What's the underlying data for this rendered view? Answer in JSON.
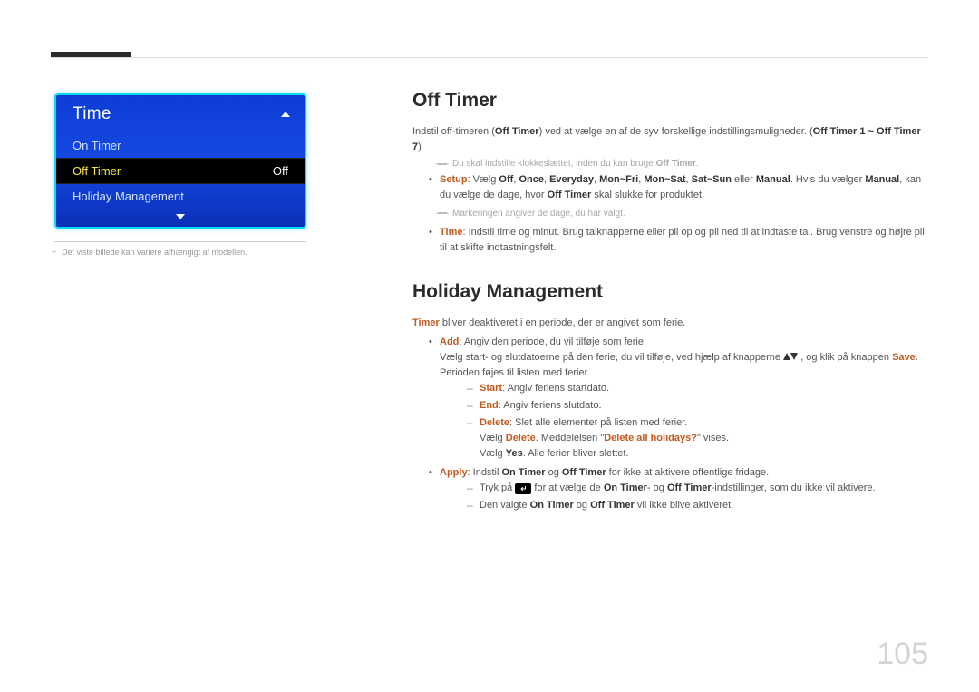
{
  "tv": {
    "title": "Time",
    "items": {
      "on_timer": "On Timer",
      "off_timer_label": "Off Timer",
      "off_timer_value": "Off",
      "holiday": "Holiday Management"
    }
  },
  "sidebar_caption": "Det viste billede kan variere afhængigt af modellen.",
  "section_off": {
    "heading": "Off Timer",
    "intro_a": "Indstil off-timeren (",
    "intro_bold": "Off Timer",
    "intro_b": ") ved at vælge en af de syv forskellige indstillingsmuligheder. (",
    "intro_range": "Off Timer 1 ~ Off Timer 7",
    "intro_c": ")",
    "note_prefix": "Du skal indstille klokkeslættet, inden du kan bruge ",
    "note_bold": "Off Timer",
    "setup_label": "Setup",
    "setup_text_a": ": Vælg ",
    "opt_off": "Off",
    "opt_once": "Once",
    "opt_everyday": "Everyday",
    "opt_monfri": "Mon~Fri",
    "opt_monsat": "Mon~Sat",
    "opt_satsun": "Sat~Sun",
    "opt_manual": "Manual",
    "setup_text_b": ". Hvis du vælger ",
    "setup_text_c": ", kan du vælge de dage, hvor ",
    "setup_text_d": " skal slukke for produktet.",
    "setup_note": "Markeringen angiver de dage, du har valgt.",
    "time_label": "Time",
    "time_text": ": Indstil time og minut. Brug talknapperne eller pil op og pil ned til at indtaste tal. Brug venstre og højre pil til at skifte indtastningsfelt."
  },
  "section_hol": {
    "heading": "Holiday Management",
    "intro_timer": "Timer",
    "intro_text": " bliver deaktiveret i en periode, der er angivet som ferie.",
    "add_label": "Add",
    "add_text": ": Angiv den periode, du vil tilføje som ferie.",
    "add_line2a": "Vælg start- og slutdatoerne på den ferie, du vil tilføje, ved hjælp af knapperne ",
    "add_line2b": ", og klik på knappen ",
    "save": "Save",
    "add_line3": "Perioden føjes til listen med ferier.",
    "start_label": "Start",
    "start_text": ": Angiv feriens startdato.",
    "end_label": "End",
    "end_text": ": Angiv feriens slutdato.",
    "delete_label": "Delete",
    "delete_text": ": Slet alle elementer på listen med ferier.",
    "delete_line2a": "Vælg ",
    "delete_bold": "Delete",
    "delete_line2b": ". Meddelelsen \"",
    "delete_q": "Delete all holidays?",
    "delete_line2c": "\" vises.",
    "delete_line3a": "Vælg ",
    "yes": "Yes",
    "delete_line3b": ". Alle ferier bliver slettet.",
    "apply_label": "Apply",
    "apply_text_a": ": Indstil ",
    "on_timer": "On Timer",
    "off_timer": "Off Timer",
    "apply_text_b": " og ",
    "apply_text_c": " for ikke at aktivere offentlige fridage.",
    "apply_sub1a": "Tryk på ",
    "apply_sub1b": " for at vælge de ",
    "apply_sub1c": "- og ",
    "apply_sub1d": "-indstillinger, som du ikke vil aktivere.",
    "apply_sub2a": "Den valgte ",
    "apply_sub2b": " og ",
    "apply_sub2c": " vil ikke blive aktiveret."
  },
  "page_number": "105"
}
